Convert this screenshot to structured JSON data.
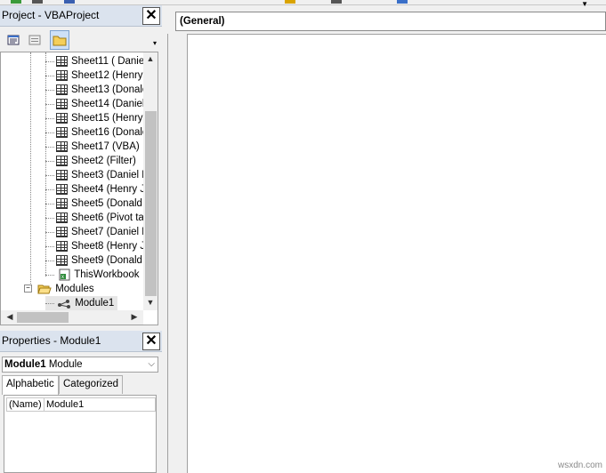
{
  "project_pane": {
    "title": "Project - VBAProject",
    "close_label": "✕",
    "toolbar": [
      {
        "name": "view-code",
        "icon": "view-code-icon"
      },
      {
        "name": "view-object",
        "icon": "view-object-icon"
      },
      {
        "name": "toggle-folders",
        "icon": "folder-icon"
      }
    ],
    "tree": {
      "sheets": [
        "Sheet11 ( Daniel",
        "Sheet12 (Henry",
        "Sheet13 (Donalc",
        "Sheet14 (Daniel",
        "Sheet15 (Henry",
        "Sheet16 (Donalc",
        "Sheet17 (VBA)",
        "Sheet2 (Filter)",
        "Sheet3 (Daniel D",
        "Sheet4 (Henry J",
        "Sheet5 (Donald I",
        "Sheet6 (Pivot ta",
        "Sheet7 (Daniel D",
        "Sheet8 (Henry J",
        "Sheet9 (Donald I"
      ],
      "workbook": "ThisWorkbook",
      "modules_folder": "Modules",
      "modules": [
        "Module1"
      ]
    }
  },
  "properties_pane": {
    "title": "Properties - Module1",
    "close_label": "✕",
    "object_name": "Module1",
    "object_type": "Module",
    "tabs": [
      "Alphabetic",
      "Categorized"
    ],
    "rows": [
      {
        "name": "(Name)",
        "value": "Module1"
      }
    ]
  },
  "code_window": {
    "object_combo": "(General)"
  },
  "watermark": "wsxdn.com",
  "colors": {
    "pane_title_bg": "#dbe3ee",
    "chrome_bg": "#f0f0f0",
    "selection_border": "#7da2ce"
  }
}
